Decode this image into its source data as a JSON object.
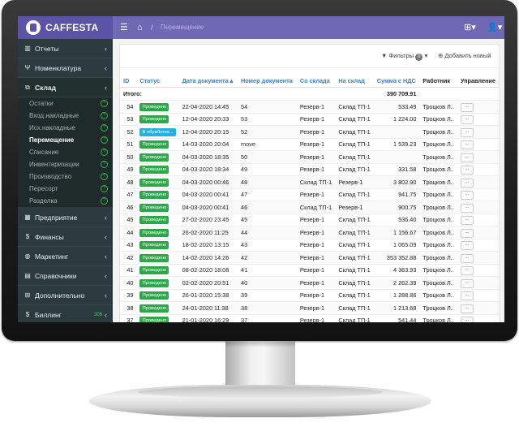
{
  "app": {
    "brand": "CAFFESTA",
    "breadcrumb": "Перемещение"
  },
  "sidebar": {
    "items": [
      {
        "icon": "bar-chart-icon",
        "label": "Отчеты"
      },
      {
        "icon": "cutlery-icon",
        "label": "Номенклатура"
      },
      {
        "icon": "cubes-icon",
        "label": "Склад"
      },
      {
        "icon": "building-icon",
        "label": "Предприятие"
      },
      {
        "icon": "dollar-icon",
        "label": "Финансы"
      },
      {
        "icon": "globe-icon",
        "label": "Маркетинг"
      },
      {
        "icon": "book-icon",
        "label": "Справочники"
      },
      {
        "icon": "plus-square-icon",
        "label": "Дополнительно"
      },
      {
        "icon": "dollar-icon",
        "label": "Биллинг",
        "badge": "306"
      }
    ],
    "subitems": [
      "Остатки",
      "Вход.накладные",
      "Исх.накладные",
      "Перемещение",
      "Списание",
      "Инвентаризации",
      "Производство",
      "Пересорт",
      "Разделка"
    ]
  },
  "toolbar": {
    "filters_label": "Фильтры",
    "filters_count": "0",
    "add_label": "Добавить новый"
  },
  "table": {
    "headers": [
      "ID",
      "Статус",
      "Дата документа",
      "Номер документа",
      "Со склада",
      "На склад",
      "Сумма с НДС",
      "Работник",
      "Управление"
    ],
    "total_label": "Итого:",
    "total_value": "390 709.91",
    "action_label": "...",
    "rows": [
      {
        "id": "54",
        "status": "Проведено",
        "kind": "done",
        "date": "22-04-2020 14:45",
        "num": "54",
        "from": "Резерв-1",
        "to": "Склад ТП-1",
        "sum": "533.49",
        "worker": "Троцков Л.."
      },
      {
        "id": "53",
        "status": "Проведено",
        "kind": "done",
        "date": "12-04-2020 20:33",
        "num": "53",
        "from": "Резерв-1",
        "to": "Склад ТП-1",
        "sum": "1 224.00",
        "worker": "Троцков Л.."
      },
      {
        "id": "52",
        "status": "В обработке...",
        "kind": "proc",
        "date": "12-04-2020 20:15",
        "num": "52",
        "from": "Резерв-1",
        "to": "Склад ТП-1",
        "sum": "",
        "worker": "Троцков Л.."
      },
      {
        "id": "51",
        "status": "Проведено",
        "kind": "done",
        "date": "14-03-2020 20:04",
        "num": "move",
        "from": "Резерв-1",
        "to": "Склад ТП-1",
        "sum": "1 539.23",
        "worker": "Троцков Л.."
      },
      {
        "id": "50",
        "status": "Проведено",
        "kind": "done",
        "date": "04-03-2020 18:35",
        "num": "50",
        "from": "Резерв-1",
        "to": "Склад ТП-1",
        "sum": "",
        "worker": "Троцков Л.."
      },
      {
        "id": "49",
        "status": "Проведено",
        "kind": "done",
        "date": "04-03-2020 18:34",
        "num": "49",
        "from": "Резерв-1",
        "to": "Склад ТП-1",
        "sum": "331.58",
        "worker": "Троцков Л.."
      },
      {
        "id": "48",
        "status": "Проведено",
        "kind": "done",
        "date": "04-03-2020 00:46",
        "num": "48",
        "from": "Склад ТП-1",
        "to": "Резерв-1",
        "sum": "3 802.90",
        "worker": "Троцков Л.."
      },
      {
        "id": "47",
        "status": "Проведено",
        "kind": "done",
        "date": "04-03-2020 00:41",
        "num": "47",
        "from": "Резерв-1",
        "to": "Склад ТП-1",
        "sum": "941.75",
        "worker": "Троцков Л.."
      },
      {
        "id": "46",
        "status": "Проведено",
        "kind": "done",
        "date": "04-03-2020 00:41",
        "num": "46",
        "from": "Склад ТП-1",
        "to": "Резерв-1",
        "sum": "900.75",
        "worker": "Троцков Л.."
      },
      {
        "id": "45",
        "status": "Проведено",
        "kind": "done",
        "date": "27-02-2020 23:45",
        "num": "45",
        "from": "Резерв-1",
        "to": "Склад ТП-1",
        "sum": "536.40",
        "worker": "Троцков Л.."
      },
      {
        "id": "44",
        "status": "Проведено",
        "kind": "done",
        "date": "26-02-2020 11:25",
        "num": "44",
        "from": "Резерв-1",
        "to": "Склад ТП-1",
        "sum": "1 156.67",
        "worker": "Троцков Л.."
      },
      {
        "id": "43",
        "status": "Проведено",
        "kind": "done",
        "date": "18-02-2020 13:15",
        "num": "43",
        "from": "Резерв-1",
        "to": "Склад ТП-1",
        "sum": "1 065.09",
        "worker": "Троцков Л.."
      },
      {
        "id": "42",
        "status": "Проведено",
        "kind": "done",
        "date": "14-02-2020 14:26",
        "num": "42",
        "from": "Резерв-1",
        "to": "Склад ТП-1",
        "sum": "353 352.88",
        "worker": "Троцков Л.."
      },
      {
        "id": "41",
        "status": "Проведено",
        "kind": "done",
        "date": "08-02-2020 18:08",
        "num": "41",
        "from": "Резерв-1",
        "to": "Склад ТП-1",
        "sum": "4 363.93",
        "worker": "Троцков Л.."
      },
      {
        "id": "40",
        "status": "Проведено",
        "kind": "done",
        "date": "02-02-2020 20:51",
        "num": "40",
        "from": "Резерв-1",
        "to": "Склад ТП-1",
        "sum": "2 262.39",
        "worker": "Троцков Л.."
      },
      {
        "id": "39",
        "status": "Проведено",
        "kind": "done",
        "date": "26-01-2020 15:38",
        "num": "39",
        "from": "Резерв-1",
        "to": "Склад ТП-1",
        "sum": "1 288.86",
        "worker": "Троцков Л.."
      },
      {
        "id": "38",
        "status": "Проведено",
        "kind": "done",
        "date": "24-01-2020 11:38",
        "num": "38",
        "from": "Резерв-1",
        "to": "Склад ТП-1",
        "sum": "1 213.68",
        "worker": "Троцков Л.."
      },
      {
        "id": "37",
        "status": "Проведено",
        "kind": "done",
        "date": "21-01-2020 16:29",
        "num": "37",
        "from": "Резерв-1",
        "to": "Склад ТП-1",
        "sum": "541.44",
        "worker": "Троцков Л.."
      }
    ]
  }
}
